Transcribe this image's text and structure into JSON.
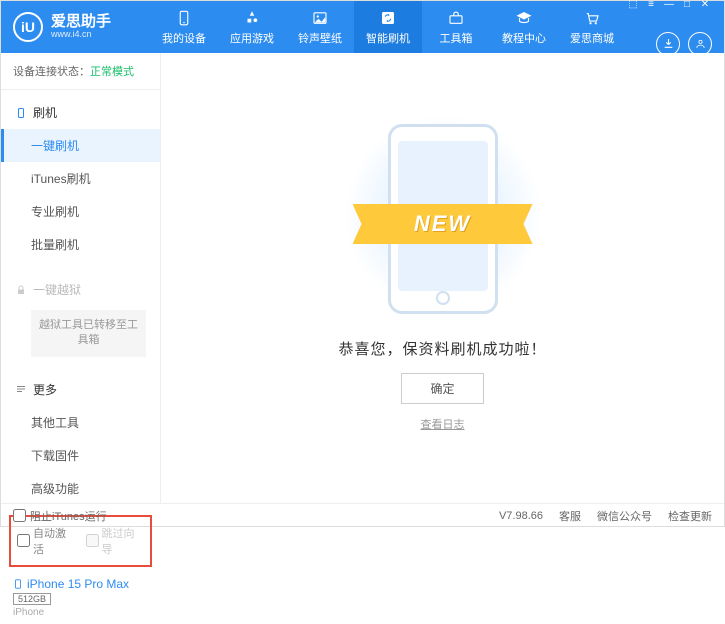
{
  "app": {
    "name": "爱思助手",
    "url": "www.i4.cn",
    "logo_letter": "iU"
  },
  "nav": [
    {
      "label": "我的设备"
    },
    {
      "label": "应用游戏"
    },
    {
      "label": "铃声壁纸"
    },
    {
      "label": "智能刷机"
    },
    {
      "label": "工具箱"
    },
    {
      "label": "教程中心"
    },
    {
      "label": "爱思商城"
    }
  ],
  "status": {
    "label": "设备连接状态：",
    "value": "正常模式"
  },
  "sidebar": {
    "flash": {
      "header": "刷机",
      "items": [
        "一键刷机",
        "iTunes刷机",
        "专业刷机",
        "批量刷机"
      ]
    },
    "jailbreak": {
      "header": "一键越狱",
      "note": "越狱工具已转移至工具箱"
    },
    "more": {
      "header": "更多",
      "items": [
        "其他工具",
        "下载固件",
        "高级功能"
      ]
    },
    "checkboxes": {
      "auto_activate": "自动激活",
      "skip_guide": "跳过向导"
    },
    "device": {
      "name": "iPhone 15 Pro Max",
      "storage": "512GB",
      "type": "iPhone"
    }
  },
  "main": {
    "ribbon": "NEW",
    "success": "恭喜您，保资料刷机成功啦！",
    "ok": "确定",
    "log": "查看日志"
  },
  "footer": {
    "block_itunes": "阻止iTunes运行",
    "version": "V7.98.66",
    "links": [
      "客服",
      "微信公众号",
      "检查更新"
    ]
  }
}
